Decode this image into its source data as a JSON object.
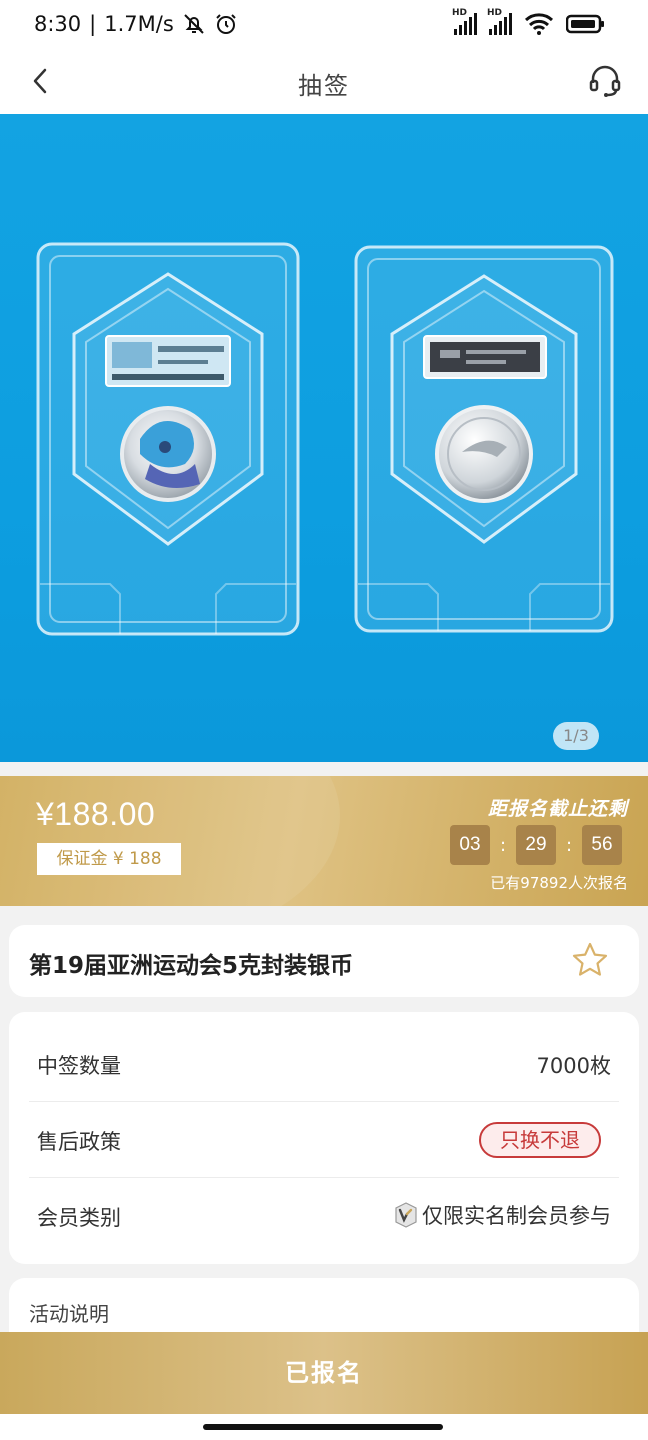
{
  "status_bar": {
    "time": "8:30",
    "net_speed": "1.7M/s",
    "icons": [
      "bell-off-icon",
      "alarm-icon",
      "signal-hd-icon",
      "signal-hd-icon",
      "wifi-icon",
      "battery-icon"
    ],
    "signal_label": "HD"
  },
  "nav": {
    "title": "抽签",
    "back_icon": "back-arrow-icon",
    "service_icon": "customer-service-headset-icon"
  },
  "hero": {
    "image_description_icons": [
      "coin-package-front",
      "coin-package-back"
    ],
    "counter": "1/3"
  },
  "price_banner": {
    "price": "¥188.00",
    "deposit": "保证金 ¥ 188",
    "countdown_title": "距报名截止还剩",
    "countdown": {
      "hours": "03",
      "minutes": "29",
      "seconds": "56",
      "separator": ":"
    },
    "signup_count": "已有97892人次报名"
  },
  "product": {
    "title": "第19届亚洲运动会5克封装银币",
    "favorite_icon": "star-outline-icon"
  },
  "info": {
    "rows": [
      {
        "label": "中签数量",
        "value": "7000枚"
      },
      {
        "label": "售后政策",
        "value": "只换不退"
      },
      {
        "label": "会员类别",
        "value": "仅限实名制会员参与"
      }
    ]
  },
  "description": {
    "title": "活动说明"
  },
  "bottom_button": {
    "label": "已报名"
  },
  "colors": {
    "gold": "#d4b066",
    "hero_blue": "#0d9ee0",
    "badge_red": "#c73a3a",
    "countdown_box": "#a8834a"
  }
}
